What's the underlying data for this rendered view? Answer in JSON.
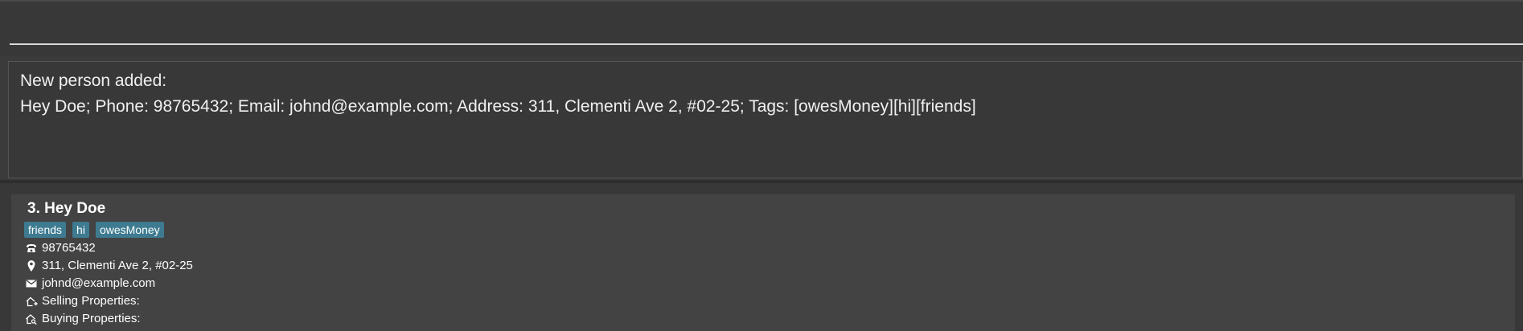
{
  "command": {
    "value": "",
    "placeholder": ""
  },
  "result": {
    "line1": "New person added:",
    "line2": "Hey Doe; Phone: 98765432; Email: johnd@example.com; Address: 311, Clementi Ave 2, #02-25; Tags: [owesMoney][hi][friends]"
  },
  "person": {
    "index_name": "3. Hey Doe",
    "tags": [
      "friends",
      "hi",
      "owesMoney"
    ],
    "phone": "98765432",
    "address": "311, Clementi Ave 2, #02-25",
    "email": "johnd@example.com",
    "selling": "Selling Properties:",
    "buying": "Buying Properties:",
    "icons": {
      "phone": "phone-icon",
      "address": "location-pin-icon",
      "email": "mail-icon",
      "selling": "house-out-icon",
      "buying": "house-search-icon"
    }
  },
  "colors": {
    "background": "#3b3b3b",
    "panel": "#383838",
    "card": "#434343",
    "tag": "#3e7b91",
    "text": "#ffffff"
  }
}
